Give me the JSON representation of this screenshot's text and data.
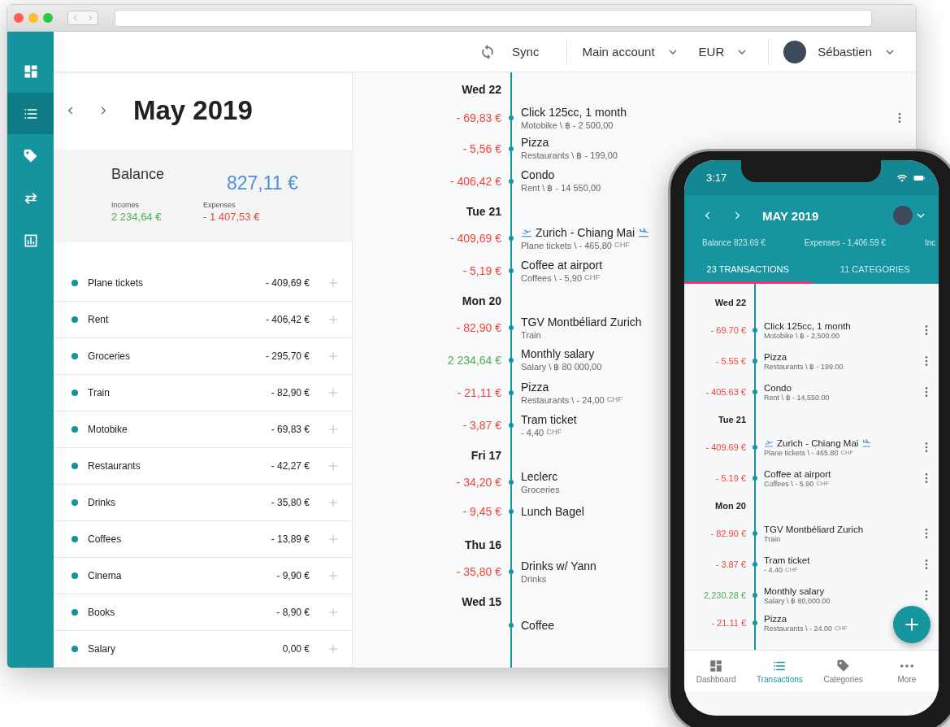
{
  "sidebar": {
    "items": [
      {
        "kind": "dashboard",
        "selected": false
      },
      {
        "kind": "list",
        "selected": true
      },
      {
        "kind": "tag",
        "selected": false
      },
      {
        "kind": "transfer",
        "selected": false
      },
      {
        "kind": "chart",
        "selected": false
      }
    ]
  },
  "topbar": {
    "sync": "Sync",
    "account": "Main account",
    "currency": "EUR",
    "user": "Sébastien"
  },
  "month": {
    "title": "May 2019"
  },
  "balance": {
    "label": "Balance",
    "amount": "827,11 €",
    "incomes": {
      "label": "Incomes",
      "value": "2 234,64 €"
    },
    "expenses": {
      "label": "Expenses",
      "value": "- 1 407,53 €"
    }
  },
  "categories": [
    {
      "name": "Plane tickets",
      "amount": "- 409,69 €"
    },
    {
      "name": "Rent",
      "amount": "- 406,42 €"
    },
    {
      "name": "Groceries",
      "amount": "- 295,70 €"
    },
    {
      "name": "Train",
      "amount": "- 82,90 €"
    },
    {
      "name": "Motobike",
      "amount": "- 69,83 €"
    },
    {
      "name": "Restaurants",
      "amount": "- 42,27 €"
    },
    {
      "name": "Drinks",
      "amount": "- 35,80 €"
    },
    {
      "name": "Coffees",
      "amount": "- 13,89 €"
    },
    {
      "name": "Cinema",
      "amount": "- 9,90 €"
    },
    {
      "name": "Books",
      "amount": "- 8,90 €"
    },
    {
      "name": "Salary",
      "amount": "0,00 €"
    }
  ],
  "timeline": [
    {
      "date": "Wed 22",
      "transactions": [
        {
          "kind": "expense",
          "amount": "- 69,83 €",
          "title": "Click 125cc, 1 month",
          "detail": "Motobike \\ ฿ - 2 500,00",
          "menu": true
        },
        {
          "kind": "expense",
          "amount": "- 5,56 €",
          "title": "Pizza",
          "detail": "Restaurants \\ ฿ - 199,00"
        },
        {
          "kind": "expense",
          "amount": "- 406,42 €",
          "title": "Condo",
          "detail": "Rent \\ ฿ - 14 550,00"
        }
      ]
    },
    {
      "date": "Tue 21",
      "transactions": [
        {
          "kind": "expense",
          "amount": "- 409,69 €",
          "title": "Zurich - Chiang Mai",
          "flight": true,
          "detail": "Plane tickets \\ - 465,80",
          "currency": "CHF"
        },
        {
          "kind": "expense",
          "amount": "- 5,19 €",
          "title": "Coffee at airport",
          "detail": "Coffees \\ - 5,90",
          "currency": "CHF"
        }
      ]
    },
    {
      "date": "Mon 20",
      "transactions": [
        {
          "kind": "expense",
          "amount": "- 82,90 €",
          "title": "TGV Montbéliard Zurich",
          "detail": "Train"
        },
        {
          "kind": "income",
          "amount": "2 234,64 €",
          "title": "Monthly salary",
          "detail": "Salary \\ ฿ 80 000,00"
        },
        {
          "kind": "expense",
          "amount": "- 21,11 €",
          "title": "Pizza",
          "detail": "Restaurants \\ - 24,00",
          "currency": "CHF"
        },
        {
          "kind": "expense",
          "amount": "- 3,87 €",
          "title": "Tram ticket",
          "detail": "- 4,40",
          "currency": "CHF"
        }
      ]
    },
    {
      "date": "Fri 17",
      "transactions": [
        {
          "kind": "expense",
          "amount": "- 34,20 €",
          "title": "Leclerc",
          "detail": "Groceries"
        },
        {
          "kind": "expense",
          "amount": "- 9,45 €",
          "title": "Lunch Bagel"
        }
      ]
    },
    {
      "date": "Thu 16",
      "transactions": [
        {
          "kind": "expense",
          "amount": "- 35,80 €",
          "title": "Drinks w/ Yann",
          "detail": "Drinks"
        }
      ]
    },
    {
      "date": "Wed 15",
      "transactions": [
        {
          "kind": "expense",
          "title": "Coffee"
        }
      ]
    }
  ],
  "phone": {
    "time": "3:17",
    "title": "MAY 2019",
    "summary": [
      "Balance 823.69 €",
      "Expenses - 1,406.59 €",
      "Inc"
    ],
    "tabs": [
      {
        "label": "23 TRANSACTIONS",
        "selected": true
      },
      {
        "label": "11 CATEGORIES",
        "selected": false
      }
    ],
    "timeline": [
      {
        "date": "Wed 22",
        "transactions": [
          {
            "kind": "expense",
            "amount": "- 69.70 €",
            "title": "Click 125cc, 1 month",
            "detail": "Motobike \\ ฿ - 2,500.00"
          },
          {
            "kind": "expense",
            "amount": "- 5.55 €",
            "title": "Pizza",
            "detail": "Restaurants \\ ฿ - 199.00"
          },
          {
            "kind": "expense",
            "amount": "- 405.63 €",
            "title": "Condo",
            "detail": "Rent \\ ฿ - 14,550.00"
          }
        ]
      },
      {
        "date": "Tue 21",
        "transactions": [
          {
            "kind": "expense",
            "amount": "- 409.69 €",
            "title": "Zurich - Chiang Mai",
            "flight": true,
            "detail": "Plane tickets \\ - 465.80",
            "currency": "CHF"
          },
          {
            "kind": "expense",
            "amount": "- 5.19 €",
            "title": "Coffee at airport",
            "detail": "Coffees \\ - 5.90",
            "currency": "CHF"
          }
        ]
      },
      {
        "date": "Mon 20",
        "transactions": [
          {
            "kind": "expense",
            "amount": "- 82.90 €",
            "title": "TGV Montbéliard Zurich",
            "detail": "Train"
          },
          {
            "kind": "expense",
            "amount": "- 3.87 €",
            "title": "Tram ticket",
            "detail": "- 4.40",
            "currency": "CHF"
          },
          {
            "kind": "income",
            "amount": "2,230.28 €",
            "title": "Monthly salary",
            "detail": "Salary \\ ฿ 80,000.00"
          },
          {
            "kind": "expense",
            "amount": "- 21.11 €",
            "title": "Pizza",
            "detail": "Restaurants \\ - 24.00",
            "currency": "CHF",
            "menu": false
          }
        ]
      }
    ],
    "nav": [
      {
        "kind": "dashboard",
        "label": "Dashboard",
        "selected": false
      },
      {
        "kind": "list",
        "label": "Transactions",
        "selected": true
      },
      {
        "kind": "tag",
        "label": "Categories",
        "selected": false
      },
      {
        "kind": "more",
        "label": "More",
        "selected": false
      }
    ]
  }
}
